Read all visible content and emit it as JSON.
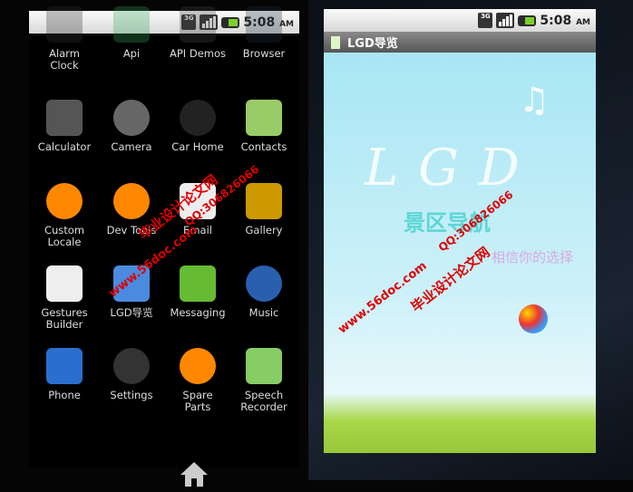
{
  "status": {
    "time": "5:08",
    "ampm": "AM",
    "network": "3G"
  },
  "launcher": {
    "apps": [
      {
        "label": "Alarm Clock",
        "icon": "alarm-clock-icon"
      },
      {
        "label": "Api",
        "icon": "api-icon"
      },
      {
        "label": "API Demos",
        "icon": "api-demos-icon"
      },
      {
        "label": "Browser",
        "icon": "browser-icon"
      },
      {
        "label": "Calculator",
        "icon": "calculator-icon"
      },
      {
        "label": "Camera",
        "icon": "camera-icon"
      },
      {
        "label": "Car Home",
        "icon": "car-home-icon"
      },
      {
        "label": "Contacts",
        "icon": "contacts-icon"
      },
      {
        "label": "Custom Locale",
        "icon": "gear-icon"
      },
      {
        "label": "Dev Tools",
        "icon": "gear-icon"
      },
      {
        "label": "Email",
        "icon": "email-icon"
      },
      {
        "label": "Gallery",
        "icon": "gallery-icon"
      },
      {
        "label": "Gestures Builder",
        "icon": "gestures-icon"
      },
      {
        "label": "LGD导览",
        "icon": "lgd-icon"
      },
      {
        "label": "Messaging",
        "icon": "messaging-icon"
      },
      {
        "label": "Music",
        "icon": "music-icon"
      },
      {
        "label": "Phone",
        "icon": "phone-icon"
      },
      {
        "label": "Settings",
        "icon": "settings-icon"
      },
      {
        "label": "Spare Parts",
        "icon": "gear-icon"
      },
      {
        "label": "Speech Recorder",
        "icon": "speech-recorder-icon"
      }
    ]
  },
  "app": {
    "title": "LGD导览",
    "splash_logo": "LGD",
    "splash_title": "景区导航",
    "splash_slogan": "相信你的选择"
  },
  "watermark": {
    "site": "www.56doc.com",
    "qq": "QQ:306826066",
    "name": "毕业设计论文网"
  }
}
